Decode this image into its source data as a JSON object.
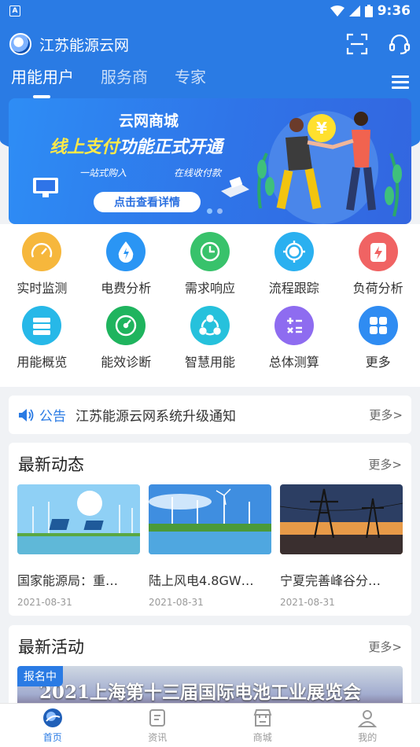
{
  "status": {
    "left_badge": "A",
    "time": "9:36"
  },
  "header": {
    "title": "江苏能源云网"
  },
  "tabs": [
    {
      "label": "用能用户"
    },
    {
      "label": "服务商"
    },
    {
      "label": "专家"
    }
  ],
  "banner": {
    "title": "云网商城",
    "headline_hl": "线上支付",
    "headline_rest": "功能正式开通",
    "sub_left": "一站式购入",
    "sub_right": "在线收付款",
    "button": "点击查看详情",
    "coin": "¥"
  },
  "grid": [
    {
      "label": "实时监测",
      "color": "#f6b73c"
    },
    {
      "label": "电费分析",
      "color": "#2a95f4"
    },
    {
      "label": "需求响应",
      "color": "#38c26b"
    },
    {
      "label": "流程跟踪",
      "color": "#2ab0f0"
    },
    {
      "label": "负荷分析",
      "color": "#f06363"
    },
    {
      "label": "用能概览",
      "color": "#27b8e8"
    },
    {
      "label": "能效诊断",
      "color": "#1fb45e"
    },
    {
      "label": "智慧用能",
      "color": "#26c1dc"
    },
    {
      "label": "总体测算",
      "color": "#8e6cf0"
    },
    {
      "label": "更多",
      "color": "#2f8cf2"
    }
  ],
  "notice": {
    "tag": "公告",
    "text": "江苏能源云网系统升级通知",
    "more": "更多>"
  },
  "news": {
    "title": "最新动态",
    "more": "更多>",
    "items": [
      {
        "title": "国家能源局：重…",
        "date": "2021-08-31"
      },
      {
        "title": "陆上风电4.8GW…",
        "date": "2021-08-31"
      },
      {
        "title": "宁夏完善峰谷分…",
        "date": "2021-08-31"
      }
    ]
  },
  "activity": {
    "title": "最新活动",
    "more": "更多>",
    "tag": "报名中",
    "banner_text": "2021上海第十三届国际电池工业展览会"
  },
  "tabbar": [
    {
      "label": "首页"
    },
    {
      "label": "资讯"
    },
    {
      "label": "商城"
    },
    {
      "label": "我的"
    }
  ]
}
